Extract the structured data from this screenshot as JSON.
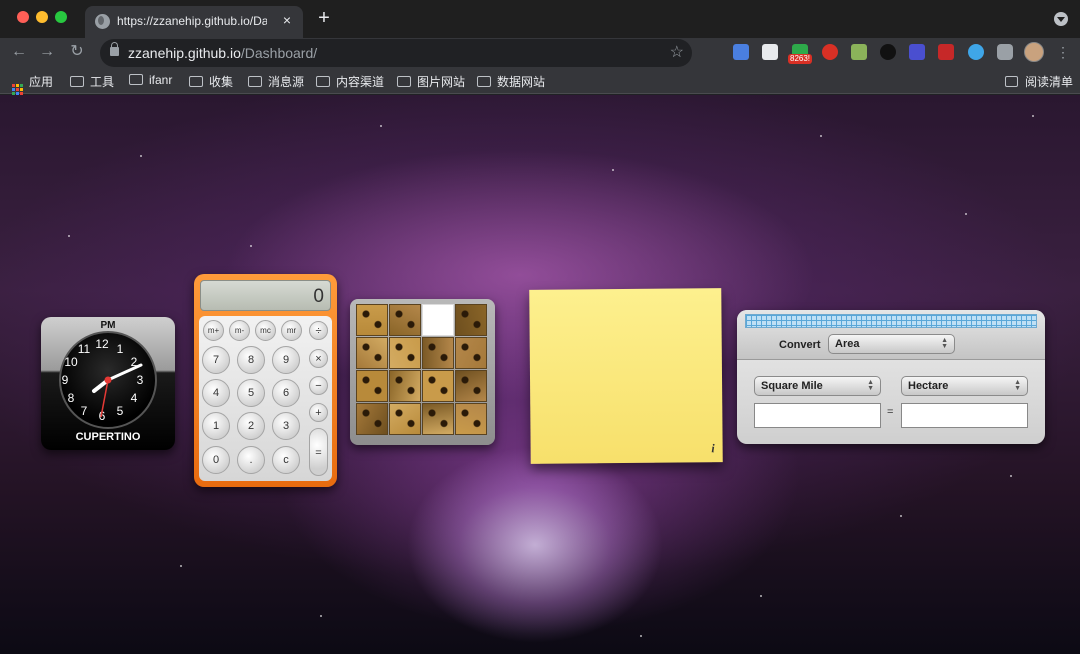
{
  "browser": {
    "tab_title": "https://zzanehip.github.io/Dash",
    "tab_close": "×",
    "new_tab": "+",
    "url_host": "zzanehip.github.io",
    "url_path": "/Dashboard/",
    "extension_badge": "8263!",
    "nav": {
      "back": "←",
      "forward": "→",
      "reload": "↻",
      "star": "☆",
      "more": "⋮"
    }
  },
  "bookmarks": {
    "apps": "应用",
    "items": [
      "工具",
      "ifanr",
      "收集",
      "消息源",
      "内容渠道",
      "图片网站",
      "数据网站"
    ],
    "reading_list": "阅读清单"
  },
  "clock": {
    "period": "PM",
    "city": "CUPERTINO",
    "numbers": [
      "12",
      "1",
      "2",
      "3",
      "4",
      "5",
      "6",
      "7",
      "8",
      "9",
      "10",
      "11"
    ]
  },
  "calculator": {
    "display": "0",
    "memory_keys": [
      "m+",
      "m-",
      "mc",
      "mr"
    ],
    "number_keys": [
      "7",
      "8",
      "9",
      "4",
      "5",
      "6",
      "1",
      "2",
      "3",
      "0",
      ".",
      "c"
    ],
    "operator_keys": [
      "÷",
      "×",
      "−",
      "+",
      "="
    ]
  },
  "sticky": {
    "info": "i"
  },
  "converter": {
    "convert_label": "Convert",
    "category": "Area",
    "from_unit": "Square Mile",
    "to_unit": "Hectare",
    "equals": "=",
    "from_value": "",
    "to_value": ""
  },
  "colors": {
    "calculator_body": "#f07a1a",
    "sticky_note": "#fbe97c",
    "converter_grid": "#bfe0f5"
  }
}
